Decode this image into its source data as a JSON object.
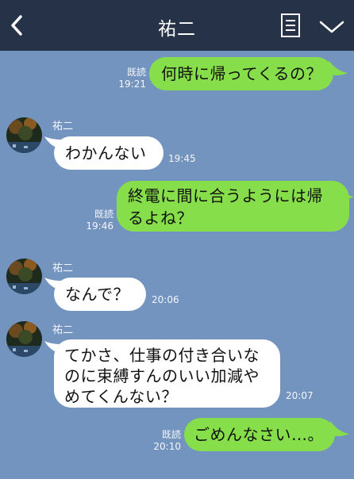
{
  "header": {
    "title": "祐二"
  },
  "colors": {
    "header_bg": "#253247",
    "chat_bg": "#7494c0",
    "sent_bubble": "#86de4a",
    "received_bubble": "#ffffff"
  },
  "icons": {
    "back": "chevron-left-icon",
    "notes": "notes-icon",
    "menu": "chevron-down-icon"
  },
  "messages": [
    {
      "side": "sent",
      "text": "何時に帰ってくるの？",
      "read": "既読",
      "time": "19:21"
    },
    {
      "side": "received",
      "sender": "祐二",
      "text": "わかんない",
      "time": "19:45"
    },
    {
      "side": "sent",
      "lines": [
        "終電に間に合うようには帰",
        "るよね？"
      ],
      "read": "既読",
      "time": "19:46"
    },
    {
      "side": "received",
      "sender": "祐二",
      "text": "なんで？",
      "time": "20:06"
    },
    {
      "side": "received",
      "sender": "祐二",
      "lines": [
        "てかさ、仕事の付き合いな",
        "のに束縛すんのいい加減や",
        "めてくんない？"
      ],
      "time": "20:07"
    },
    {
      "side": "sent",
      "text": "ごめんなさい…。",
      "read": "既読",
      "time": "20:10"
    }
  ]
}
